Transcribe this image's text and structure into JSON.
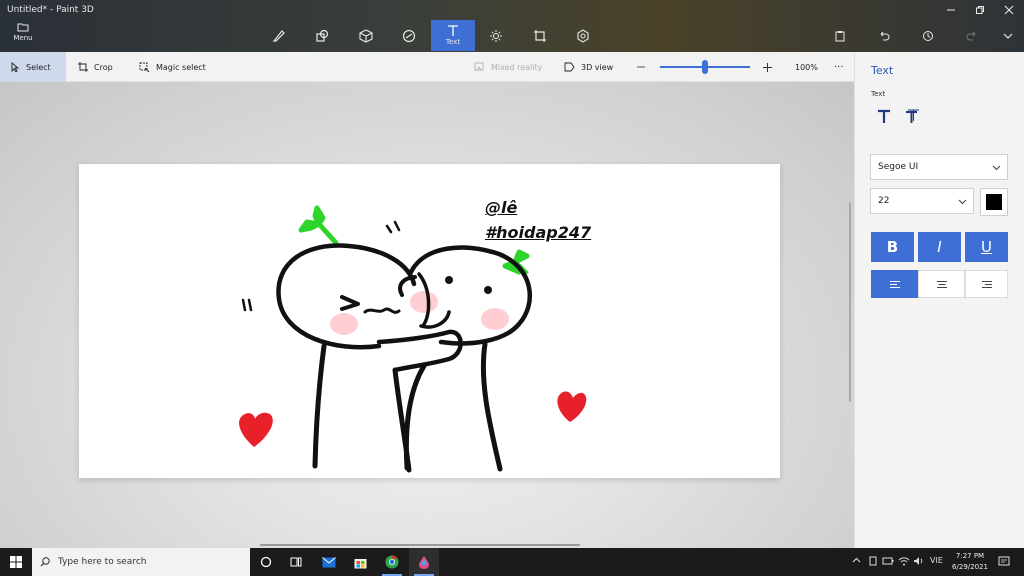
{
  "window": {
    "title": "Untitled* - Paint 3D",
    "menu_label": "Menu"
  },
  "ribbon": {
    "tools": [
      {
        "name": "brushes",
        "label": ""
      },
      {
        "name": "2d-shapes",
        "label": ""
      },
      {
        "name": "3d-shapes",
        "label": ""
      },
      {
        "name": "stickers",
        "label": ""
      },
      {
        "name": "text",
        "label": "Text"
      },
      {
        "name": "effects",
        "label": ""
      },
      {
        "name": "canvas",
        "label": ""
      },
      {
        "name": "3d-library",
        "label": ""
      }
    ]
  },
  "toolbar": {
    "select": "Select",
    "crop": "Crop",
    "magic_select": "Magic select",
    "mixed_reality": "Mixed reality",
    "view_3d": "3D view",
    "zoom_value": "100%",
    "zoom_level": 0.5,
    "more": "···"
  },
  "canvas": {
    "text_line_1": "@lê",
    "text_line_2": "#hoidap247"
  },
  "panel": {
    "title": "Text",
    "subtitle": "Text",
    "font_family": "Segoe UI",
    "font_size": "22",
    "text_color": "#000000",
    "bold_label": "B",
    "italic_label": "I",
    "underline_label": "U",
    "accent": "#3e6fd4"
  },
  "taskbar": {
    "search_placeholder": "Type here to search",
    "language": "VIE",
    "time": "7:27 PM",
    "date": "6/29/2021"
  }
}
